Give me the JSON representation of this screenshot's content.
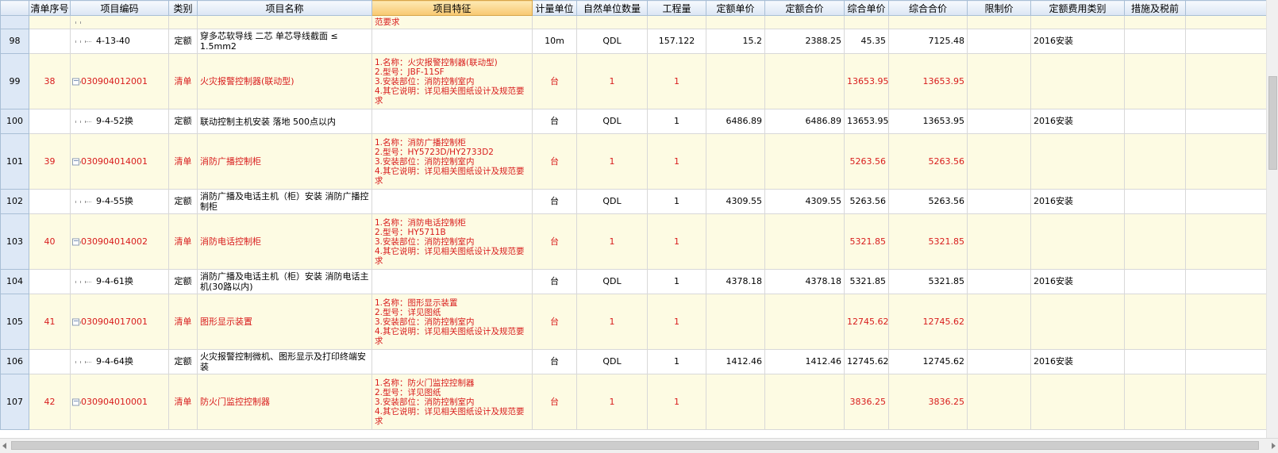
{
  "columns": {
    "c0": "",
    "c1": "清单序号",
    "c2": "项目编码",
    "c3": "类别",
    "c4": "项目名称",
    "c5": "项目特征",
    "c6": "计量单位",
    "c7": "自然单位数量",
    "c8": "工程量",
    "c9": "定额单价",
    "c10": "定额合价",
    "c11": "综合单价",
    "c12": "综合合价",
    "c13": "限制价",
    "c14": "定额费用类别",
    "c15": "措施及税前"
  },
  "top_partial": {
    "feature": "范要求"
  },
  "rows": [
    {
      "rownum": "98",
      "seq": "",
      "code": "4-13-40",
      "type": "定额",
      "name": "穿多芯软导线 二芯 单芯导线截面 ≤ 1.5mm2",
      "feat": "",
      "unit": "10m",
      "natural_qty": "QDL",
      "qty": "157.122",
      "de_price": "15.2",
      "de_total": "2388.25",
      "unit_price": "45.35",
      "total": "7125.48",
      "limit": "",
      "fee_type": "2016安装"
    },
    {
      "rownum": "99",
      "seq": "38",
      "code": "030904012001",
      "type": "清单",
      "name": "火灾报警控制器(联动型)",
      "feat": "1.名称：火灾报警控制器(联动型)\n2.型号：JBF-11SF\n3.安装部位：消防控制室内\n4.其它说明：详见相关图纸设计及规范要求",
      "unit": "台",
      "natural_qty": "1",
      "qty": "1",
      "de_price": "",
      "de_total": "",
      "unit_price": "13653.95",
      "total": "13653.95",
      "limit": "",
      "fee_type": ""
    },
    {
      "rownum": "100",
      "seq": "",
      "code": "9-4-52换",
      "type": "定额",
      "name": "联动控制主机安装 落地 500点以内",
      "feat": "",
      "unit": "台",
      "natural_qty": "QDL",
      "qty": "1",
      "de_price": "6486.89",
      "de_total": "6486.89",
      "unit_price": "13653.95",
      "total": "13653.95",
      "limit": "",
      "fee_type": "2016安装"
    },
    {
      "rownum": "101",
      "seq": "39",
      "code": "030904014001",
      "type": "清单",
      "name": "消防广播控制柜",
      "feat": "1.名称：消防广播控制柜\n2.型号：HY5723D/HY2733D2\n3.安装部位：消防控制室内\n4.其它说明：详见相关图纸设计及规范要求",
      "unit": "台",
      "natural_qty": "1",
      "qty": "1",
      "de_price": "",
      "de_total": "",
      "unit_price": "5263.56",
      "total": "5263.56",
      "limit": "",
      "fee_type": ""
    },
    {
      "rownum": "102",
      "seq": "",
      "code": "9-4-55换",
      "type": "定额",
      "name": "消防广播及电话主机（柜）安装 消防广播控制柜",
      "feat": "",
      "unit": "台",
      "natural_qty": "QDL",
      "qty": "1",
      "de_price": "4309.55",
      "de_total": "4309.55",
      "unit_price": "5263.56",
      "total": "5263.56",
      "limit": "",
      "fee_type": "2016安装"
    },
    {
      "rownum": "103",
      "seq": "40",
      "code": "030904014002",
      "type": "清单",
      "name": "消防电话控制柜",
      "feat": "1.名称：消防电话控制柜\n2.型号：HY5711B\n3.安装部位：消防控制室内\n4.其它说明：详见相关图纸设计及规范要求",
      "unit": "台",
      "natural_qty": "1",
      "qty": "1",
      "de_price": "",
      "de_total": "",
      "unit_price": "5321.85",
      "total": "5321.85",
      "limit": "",
      "fee_type": ""
    },
    {
      "rownum": "104",
      "seq": "",
      "code": "9-4-61换",
      "type": "定额",
      "name": "消防广播及电话主机（柜）安装 消防电话主机(30路以内)",
      "feat": "",
      "unit": "台",
      "natural_qty": "QDL",
      "qty": "1",
      "de_price": "4378.18",
      "de_total": "4378.18",
      "unit_price": "5321.85",
      "total": "5321.85",
      "limit": "",
      "fee_type": "2016安装"
    },
    {
      "rownum": "105",
      "seq": "41",
      "code": "030904017001",
      "type": "清单",
      "name": "图形显示装置",
      "feat": "1.名称：图形显示装置\n2.型号：详见图纸\n3.安装部位：消防控制室内\n4.其它说明：详见相关图纸设计及规范要求",
      "unit": "台",
      "natural_qty": "1",
      "qty": "1",
      "de_price": "",
      "de_total": "",
      "unit_price": "12745.62",
      "total": "12745.62",
      "limit": "",
      "fee_type": ""
    },
    {
      "rownum": "106",
      "seq": "",
      "code": "9-4-64换",
      "type": "定额",
      "name": "火灾报警控制微机、图形显示及打印终端安装",
      "feat": "",
      "unit": "台",
      "natural_qty": "QDL",
      "qty": "1",
      "de_price": "1412.46",
      "de_total": "1412.46",
      "unit_price": "12745.62",
      "total": "12745.62",
      "limit": "",
      "fee_type": "2016安装"
    },
    {
      "rownum": "107",
      "seq": "42",
      "code": "030904010001",
      "type": "清单",
      "name": "防火门监控控制器",
      "feat": "1.名称：防火门监控控制器\n2.型号：详见图纸\n3.安装部位：消防控制室内\n4.其它说明：详见相关图纸设计及规范要求",
      "unit": "台",
      "natural_qty": "1",
      "qty": "1",
      "de_price": "",
      "de_total": "",
      "unit_price": "3836.25",
      "total": "3836.25",
      "limit": "",
      "fee_type": ""
    }
  ]
}
